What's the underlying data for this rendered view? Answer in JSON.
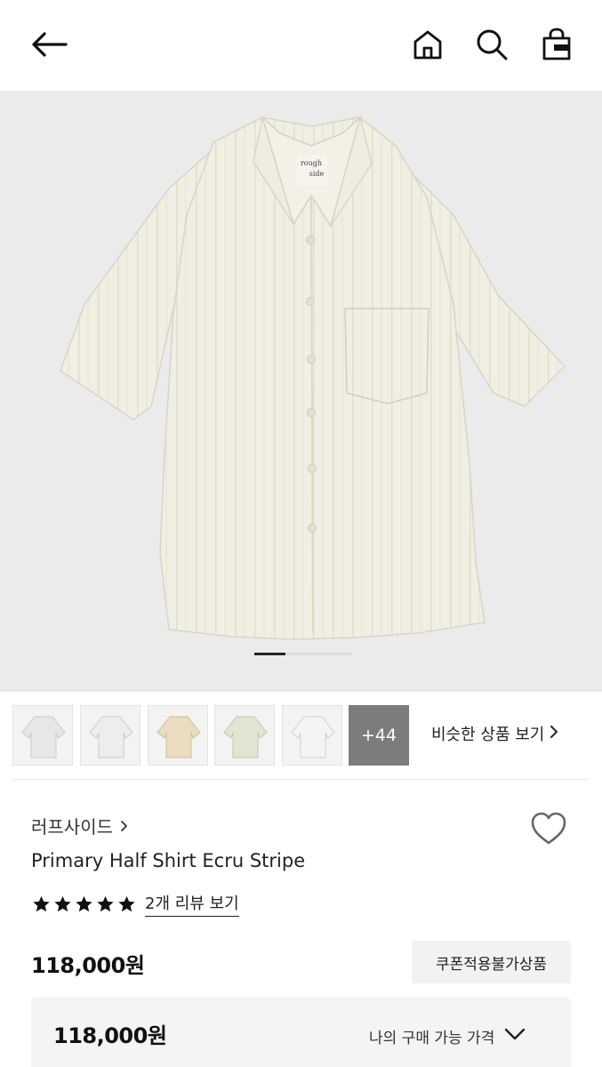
{
  "header": {
    "back_icon": "arrow-left-icon",
    "home_icon": "home-icon",
    "search_icon": "search-icon",
    "cart_icon": "shopping-bag-icon"
  },
  "product_images": {
    "main_image": "shirt-photo",
    "brand_tag": [
      "rough",
      "side"
    ],
    "current_index": 1
  },
  "thumbnails": {
    "items": [
      {
        "name": "thumb-1",
        "color": "#e7e8e6"
      },
      {
        "name": "thumb-2",
        "color": "#eceeed"
      },
      {
        "name": "thumb-3",
        "color": "#eadcc0"
      },
      {
        "name": "thumb-4",
        "color": "#e3e5d2"
      },
      {
        "name": "thumb-5",
        "color": "#f4f4f2"
      }
    ],
    "more_label": "+44",
    "similar_label": "비슷한 상품 보기"
  },
  "product": {
    "brand": "러프사이드",
    "title": "Primary Half Shirt Ecru Stripe",
    "rating_stars": 5,
    "review_link": "2개 리뷰 보기",
    "price": "118,000원",
    "coupon_badge": "쿠폰적용불가상품"
  },
  "purchase": {
    "price": "118,000원",
    "label": "나의 구매 가능 가격"
  }
}
